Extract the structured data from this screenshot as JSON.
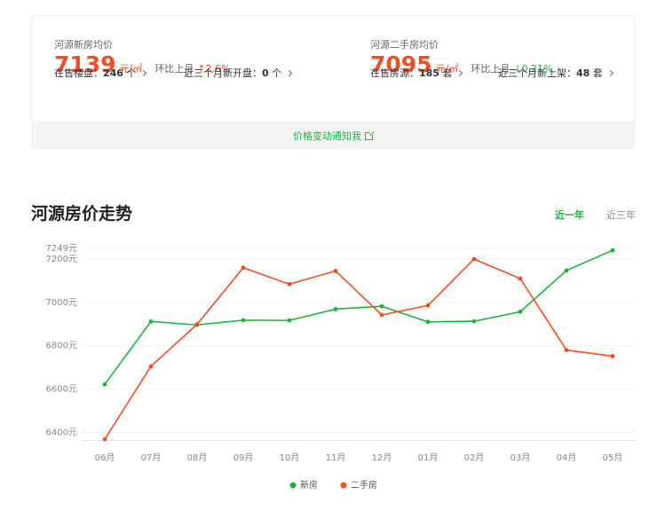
{
  "summary": {
    "new": {
      "title": "河源新房均价",
      "price": "7139",
      "unit": "元/㎡",
      "mom_label": "环比上月",
      "mom_value": "↑2.6%",
      "stat1_label": "在售楼盘：",
      "stat1_value": "246",
      "stat1_unit": " 个",
      "stat2_label": "近三个月新开盘：",
      "stat2_value": "0",
      "stat2_unit": " 个"
    },
    "second": {
      "title": "河源二手房均价",
      "price": "7095",
      "unit": "元/㎡",
      "mom_label": "环比上月",
      "mom_value": "↓0.21%",
      "stat1_label": "在售房源：",
      "stat1_value": "185",
      "stat1_unit": " 套",
      "stat2_label": "近三个月新上架：",
      "stat2_value": "48",
      "stat2_unit": " 套"
    },
    "notify_label": "价格变动通知我"
  },
  "trend": {
    "title": "河源房价走势",
    "tabs": [
      "近一年",
      "近三年"
    ],
    "active_tab": 0
  },
  "colors": {
    "green": "#1bb33e",
    "red": "#f04e23"
  },
  "chart_data": {
    "type": "line",
    "categories": [
      "06月",
      "07月",
      "08月",
      "09月",
      "10月",
      "11月",
      "12月",
      "01月",
      "02月",
      "03月",
      "04月",
      "05月"
    ],
    "series": [
      {
        "name": "新房",
        "color": "#1bb33e",
        "values": [
          6622,
          6912,
          6896,
          6918,
          6917,
          6969,
          6982,
          6910,
          6913,
          6957,
          7147,
          7240
        ]
      },
      {
        "name": "二手房",
        "color": "#f04e23",
        "values": [
          6369,
          6705,
          6899,
          7160,
          7084,
          7145,
          6942,
          6986,
          7200,
          7110,
          6780,
          6752
        ]
      }
    ],
    "y_ticks": [
      {
        "value": 6400,
        "label": "6400元"
      },
      {
        "value": 6600,
        "label": "6600元"
      },
      {
        "value": 6800,
        "label": "6800元"
      },
      {
        "value": 7000,
        "label": "7000元"
      },
      {
        "value": 7200,
        "label": "7200元"
      },
      {
        "value": 7249,
        "label": "7249元"
      }
    ],
    "ylim": [
      6365,
      7249
    ],
    "grid": true,
    "legend": "bottom-center"
  }
}
